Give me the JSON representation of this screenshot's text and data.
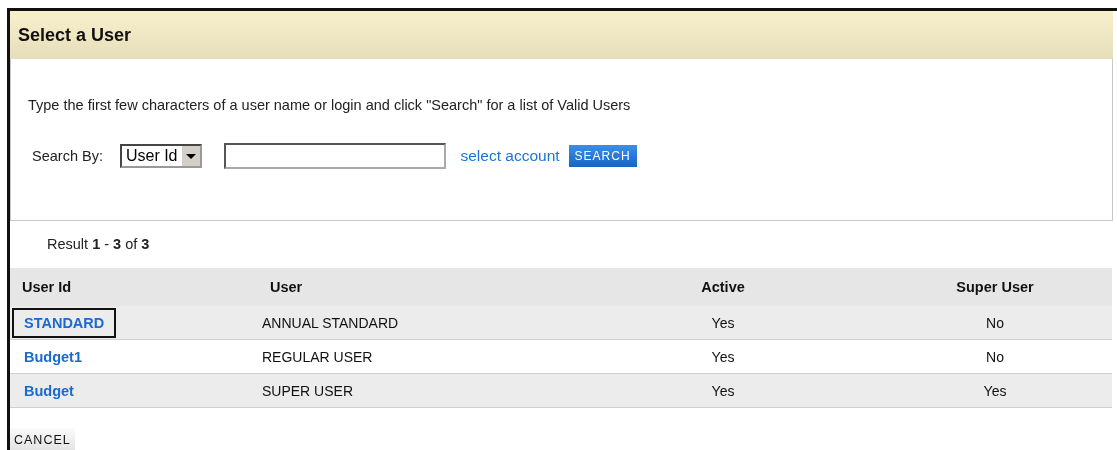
{
  "dialog": {
    "title": "Select a User"
  },
  "instructions": "Type the first few characters of a user name or login and click \"Search\" for a list of Valid Users",
  "search": {
    "label": "Search By:",
    "select_value": "User Id",
    "link": "select account",
    "button": "SEARCH"
  },
  "result_summary": "Result **1** - **3** of **3**",
  "table": {
    "columns": [
      "User Id",
      "User",
      "Active",
      "Super User"
    ],
    "rows": [
      {
        "user_id": "STANDARD",
        "user": "ANNUAL STANDARD",
        "active": "Yes",
        "super_user": "No",
        "selected": true
      },
      {
        "user_id": "Budget1",
        "user": "REGULAR USER",
        "active": "Yes",
        "super_user": "No",
        "selected": false
      },
      {
        "user_id": "Budget",
        "user": "SUPER USER",
        "active": "Yes",
        "super_user": "Yes",
        "selected": false
      }
    ]
  },
  "buttons": [
    "CANCEL"
  ]
}
